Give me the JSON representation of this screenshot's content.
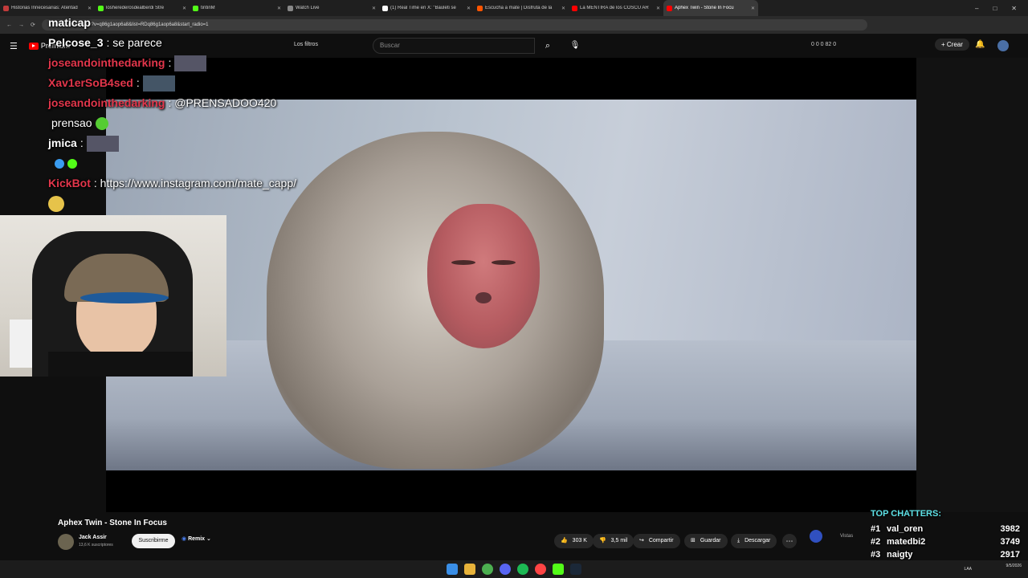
{
  "browser": {
    "tabs": [
      {
        "title": "Historias Innecesarias: Atentad",
        "active": false,
        "color": "#c23b3b"
      },
      {
        "title": "losherederosdealberdi Stre",
        "active": false,
        "color": "#53fc18"
      },
      {
        "title": "tintinM",
        "active": false,
        "color": "#53fc18"
      },
      {
        "title": "Watch Live",
        "active": false,
        "color": "#888888"
      },
      {
        "title": "(1) Real Time en X: \"Bauleti se",
        "active": false,
        "color": "#ffffff"
      },
      {
        "title": "Escucha a mate | Disfruta de la",
        "active": false,
        "color": "#ff5500"
      },
      {
        "title": "La MENTIRA de los COSCU AR",
        "active": false,
        "color": "#ff0000"
      },
      {
        "title": "Aphex Twin - Stone In Focu",
        "active": true,
        "color": "#ff0000"
      }
    ],
    "url": "youtube.com/watch?v=q86g1aop6a8&list=RDq86g1aop6a8&start_radio=1"
  },
  "youtube": {
    "logo_text": "Premium",
    "filters_label": "Los filtros",
    "search_placeholder": "Buscar",
    "header_stats": "0 0 0 82 0",
    "create_label": "Crear"
  },
  "chat": [
    {
      "user": "maticap",
      "user_color": "#ffffff",
      "message": ""
    },
    {
      "user": "Pelcose_3",
      "user_color": "#ffffff",
      "message": ": se parece"
    },
    {
      "user": "joseandointhedarking",
      "user_color": "#e2364b",
      "message": ":"
    },
    {
      "user": "Xav1erSoB4sed",
      "user_color": "#e2364b",
      "message": ":"
    },
    {
      "user": "joseandointhedarking",
      "user_color": "#e2364b",
      "message": ": @PRENSADOO420"
    },
    {
      "user": "",
      "user_color": "#ffffff",
      "message": "prensao"
    },
    {
      "user": "jmica",
      "user_color": "#ffffff",
      "message": ":"
    },
    {
      "user": "",
      "user_color": "#ffffff",
      "message": ""
    },
    {
      "user": "KickBot",
      "user_color": "#e2364b",
      "message": ": https://www.instagram.com/mate_capp/"
    }
  ],
  "video": {
    "title": "Aphex Twin - Stone In Focus",
    "channel": "Jack Assir",
    "subscribers": "13,6 K suscriptores",
    "subscribe_label": "Suscribirme",
    "remix_label": "Remix",
    "likes": "303 K",
    "dislikes": "3,5 mil",
    "share_label": "Compartir",
    "save_label": "Guardar",
    "download_label": "Descargar",
    "views_label": "Vistas"
  },
  "top_chatters": {
    "title": "TOP CHATTERS:",
    "rows": [
      {
        "rank": "#1",
        "name": "val_oren",
        "score": "3982"
      },
      {
        "rank": "#2",
        "name": "matedbi2",
        "score": "3749"
      },
      {
        "rank": "#3",
        "name": "naigty",
        "score": "2917"
      }
    ]
  },
  "taskbar": {
    "lang": "LAA",
    "date": "9/5/2026"
  }
}
